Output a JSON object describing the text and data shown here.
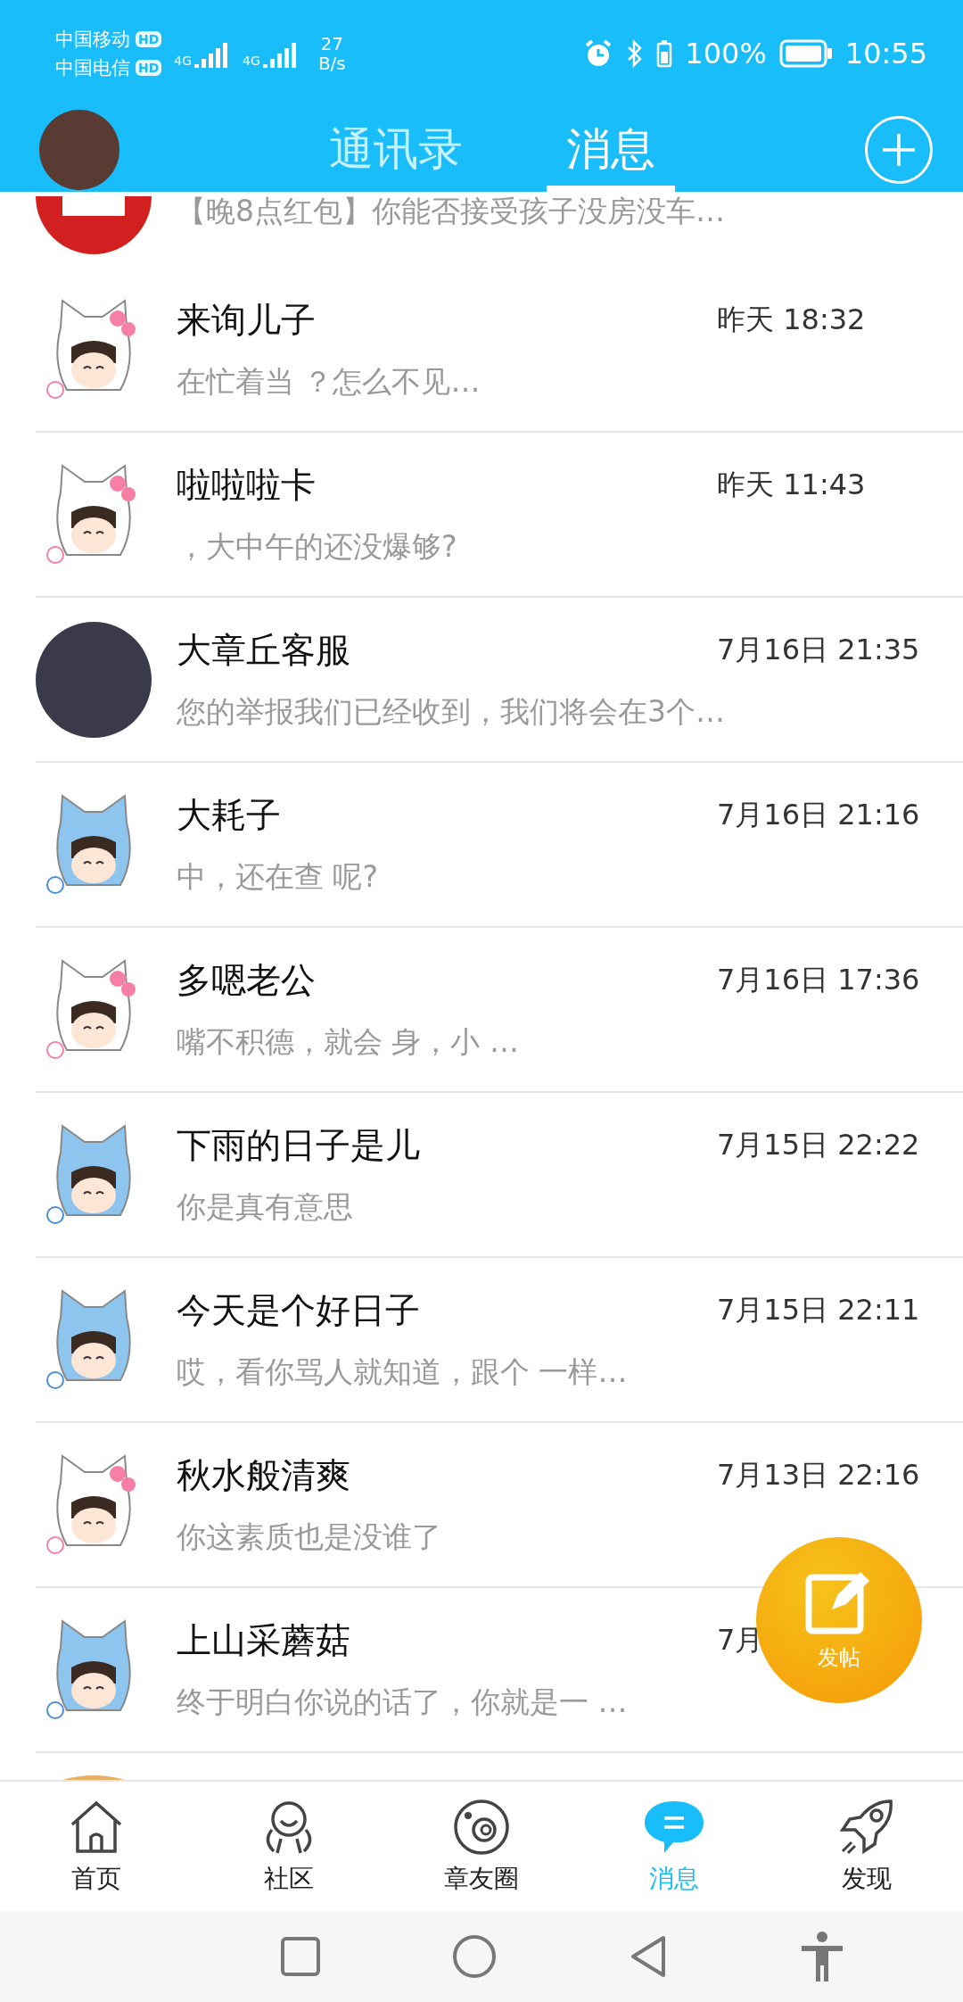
{
  "status_bar": {
    "carriers": [
      {
        "name": "中国移动",
        "badge": "HD"
      },
      {
        "name": "中国电信",
        "badge": "HD"
      }
    ],
    "signals": [
      "4G",
      "4G"
    ],
    "speed": "27",
    "speed_unit": "B/s",
    "battery": "100%",
    "time": "10:55"
  },
  "header": {
    "tabs": [
      {
        "label": "通讯录",
        "selected": false
      },
      {
        "label": "消息",
        "selected": true
      }
    ]
  },
  "top_partial": {
    "preview": "【晚8点红包】你能否接受孩子没房没车…"
  },
  "conversations": [
    {
      "kind": "cat",
      "name": "来询儿子",
      "time": "昨天 18:32",
      "preview": "在忙着当 ？怎么不见…"
    },
    {
      "kind": "cat",
      "name": "啦啦啦卡",
      "time": "昨天 11:43",
      "preview": "，大中午的还没爆够?"
    },
    {
      "kind": "photo",
      "name": "大章丘客服",
      "time": "7月16日 21:35",
      "preview": "您的举报我们已经收到，我们将会在3个…"
    },
    {
      "kind": "dog",
      "name": "大耗子",
      "time": "7月16日 21:16",
      "preview": "中，还在查 呢?"
    },
    {
      "kind": "cat",
      "name": "多嗯老公",
      "time": "7月16日 17:36",
      "preview": "嘴不积德，就会 身，小 …"
    },
    {
      "kind": "dog",
      "name": "下雨的日子是儿",
      "time": "7月15日 22:22",
      "preview": "你是真有意思"
    },
    {
      "kind": "dog",
      "name": "今天是个好日子",
      "time": "7月15日 22:11",
      "preview": "哎，看你骂人就知道，跟个 一样…"
    },
    {
      "kind": "cat",
      "name": "秋水般清爽",
      "time": "7月13日 22:16",
      "preview": "你这素质也是没谁了"
    },
    {
      "kind": "dog",
      "name": "上山采蘑菇",
      "time": "7月",
      "preview": "终于明白你说的话了，你就是一 …"
    }
  ],
  "fab": {
    "label": "发帖"
  },
  "bottom_nav": [
    {
      "kind": "home",
      "label": "首页",
      "selected": false
    },
    {
      "kind": "community",
      "label": "社区",
      "selected": false
    },
    {
      "kind": "orbit",
      "label": "章友圈",
      "selected": false
    },
    {
      "kind": "chat",
      "label": "消息",
      "selected": true
    },
    {
      "kind": "rocket",
      "label": "发现",
      "selected": false
    }
  ]
}
